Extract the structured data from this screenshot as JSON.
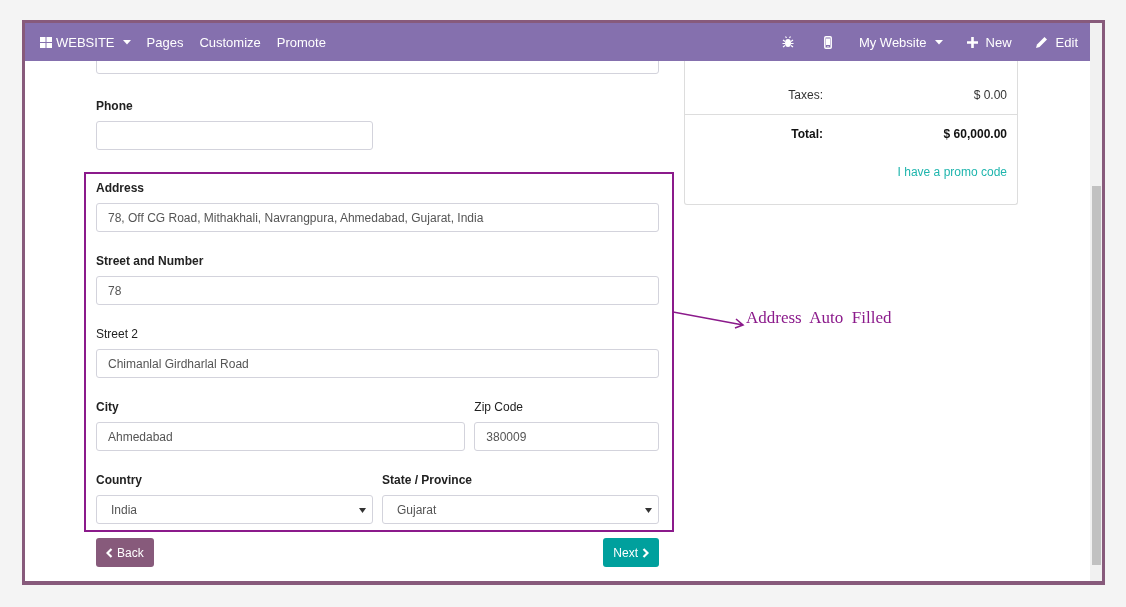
{
  "navbar": {
    "left": [
      {
        "kind": "apps",
        "label": "WEBSITE"
      },
      {
        "kind": "link",
        "label": "Pages"
      },
      {
        "kind": "link",
        "label": "Customize"
      },
      {
        "kind": "link",
        "label": "Promote"
      }
    ],
    "right": [
      {
        "kind": "debug"
      },
      {
        "kind": "mobile"
      },
      {
        "kind": "dropdown",
        "label": "My Website"
      },
      {
        "kind": "add",
        "label": "New"
      },
      {
        "kind": "edit",
        "label": "Edit"
      }
    ]
  },
  "form": {
    "top_fields": [
      {
        "kind": "input",
        "label": "Phone",
        "required": true
      }
    ],
    "address_section": [
      [
        {
          "kind": "input",
          "label": "Address",
          "value": "78, Off CG Road, Mithakhali, Navrangpura, Ahmedabad, Gujarat, India",
          "required": true
        }
      ],
      [
        {
          "kind": "input",
          "label": "Street and Number",
          "value": "78",
          "required": true
        }
      ],
      [
        {
          "kind": "input",
          "label": "Street 2",
          "value": "Chimanlal Girdharlal Road",
          "required": false
        }
      ],
      [
        {
          "kind": "input",
          "label": "City",
          "value": "Ahmedabad",
          "required": true
        },
        {
          "kind": "input",
          "label": "Zip Code",
          "value": "380009",
          "required": false
        }
      ],
      [
        {
          "kind": "select",
          "label": "Country",
          "value": "India",
          "required": true
        },
        {
          "kind": "select",
          "label": "State / Province",
          "value": "Gujarat",
          "required": true
        }
      ]
    ],
    "buttons": [
      {
        "kind": "back",
        "label": "Back"
      },
      {
        "kind": "next",
        "label": "Next"
      }
    ]
  },
  "summary": {
    "rows": [
      {
        "label": "Taxes:",
        "value": "$ 0.00",
        "total": false
      },
      {
        "label": "Total:",
        "value": "$ 60,000.00",
        "total": true
      }
    ],
    "promo_link": "I have a promo code"
  },
  "annotation": "Address  Auto  Filled"
}
